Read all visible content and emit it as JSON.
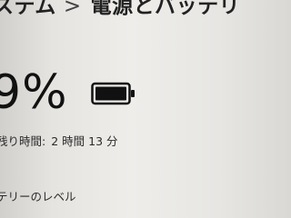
{
  "breadcrumb": {
    "parent": "ステム",
    "separator": ">",
    "current": "電源とバッテリ"
  },
  "battery": {
    "percent_text": "9%",
    "icon": "battery-full-icon",
    "charge_fraction": 1.0,
    "remaining_label": "残り時間:",
    "remaining_value": "2 時間 13 分"
  },
  "sections": {
    "level_heading": "テリーのレベル"
  }
}
